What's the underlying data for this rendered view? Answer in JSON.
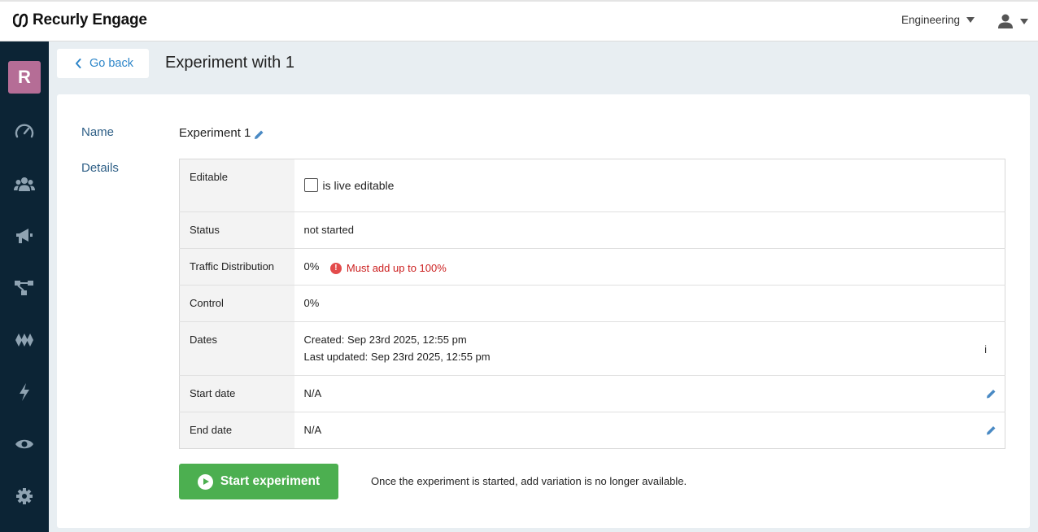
{
  "app": {
    "logo_text": "Recurly Engage",
    "org_name": "Engineering"
  },
  "sidebar": {
    "avatar_letter": "R",
    "items": [
      {
        "icon": "dashboard-icon"
      },
      {
        "icon": "users-icon"
      },
      {
        "icon": "megaphone-icon"
      },
      {
        "icon": "flow-icon"
      },
      {
        "icon": "segments-icon"
      },
      {
        "icon": "lightning-icon"
      },
      {
        "icon": "eye-icon"
      },
      {
        "icon": "gear-icon"
      }
    ]
  },
  "header": {
    "back_label": "Go back",
    "title": "Experiment with 1"
  },
  "experiment": {
    "name_label": "Name",
    "name_value": "Experiment 1",
    "details_label": "Details",
    "editable": {
      "key": "Editable",
      "checkbox_label": "is live editable",
      "checked": false
    },
    "status": {
      "key": "Status",
      "value": "not started"
    },
    "traffic": {
      "key": "Traffic Distribution",
      "value": "0%",
      "error": "Must add up to 100%"
    },
    "control": {
      "key": "Control",
      "value": "0%"
    },
    "dates": {
      "key": "Dates",
      "created": "Created: Sep 23rd 2025, 12:55 pm",
      "updated": "Last updated: Sep 23rd 2025, 12:55 pm",
      "info": "i"
    },
    "start_date": {
      "key": "Start date",
      "value": "N/A"
    },
    "end_date": {
      "key": "End date",
      "value": "N/A"
    }
  },
  "actions": {
    "start_label": "Start experiment",
    "start_note": "Once the experiment is started, add variation is no longer available."
  },
  "colors": {
    "accent": "#2e86c9",
    "sidebar": "#0c2435",
    "success": "#4caf50",
    "error": "#cc1f1f",
    "avatar": "#b56d96"
  }
}
